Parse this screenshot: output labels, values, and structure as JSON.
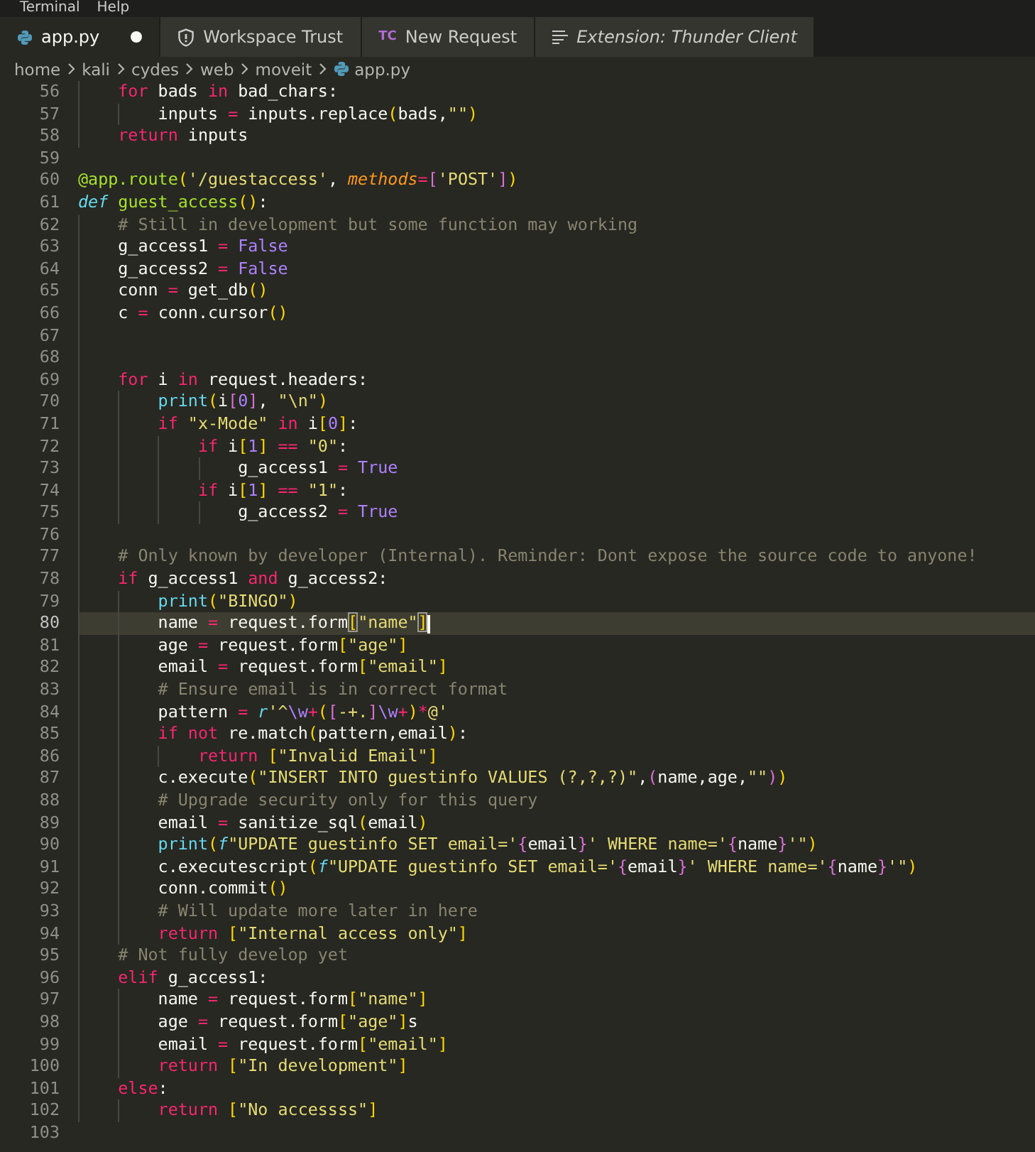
{
  "menu": [
    "Terminal",
    "Help"
  ],
  "tabs": [
    {
      "label": "app.py",
      "kind": "python",
      "selected": true,
      "modified": true,
      "preview": false
    },
    {
      "label": "Workspace Trust",
      "kind": "shield",
      "selected": false,
      "modified": false,
      "preview": false
    },
    {
      "label": "New Request",
      "kind": "badge",
      "badge": "TC",
      "selected": false,
      "modified": false,
      "preview": false
    },
    {
      "label": "Extension: Thunder Client",
      "kind": "lines",
      "selected": false,
      "modified": false,
      "preview": true
    }
  ],
  "breadcrumbs": [
    {
      "label": "home"
    },
    {
      "label": "kali"
    },
    {
      "label": "cydes"
    },
    {
      "label": "web"
    },
    {
      "label": "moveit"
    },
    {
      "label": "app.py",
      "kind": "python"
    }
  ],
  "lines": [
    {
      "number": "56",
      "current": false,
      "tokens": [
        {
          "kind": "keyword",
          "text": "    for"
        },
        {
          "kind": "plain",
          "text": " bads "
        },
        {
          "kind": "keyword",
          "text": "in"
        },
        {
          "kind": "plain",
          "text": " bad_chars:"
        }
      ]
    },
    {
      "number": "57",
      "current": false,
      "tokens": [
        {
          "kind": "plain",
          "text": "        inputs "
        },
        {
          "kind": "operator",
          "text": "="
        },
        {
          "kind": "plain",
          "text": " inputs.replace"
        },
        {
          "kind": "bracket1",
          "text": "("
        },
        {
          "kind": "plain",
          "text": "bads,"
        },
        {
          "kind": "string",
          "text": "\"\""
        },
        {
          "kind": "bracket1",
          "text": ")"
        }
      ]
    },
    {
      "number": "58",
      "current": false,
      "tokens": [
        {
          "kind": "keyword",
          "text": "    return"
        },
        {
          "kind": "plain",
          "text": " inputs"
        }
      ]
    },
    {
      "number": "59",
      "current": false
    },
    {
      "number": "60",
      "current": false,
      "tokens": [
        {
          "kind": "function",
          "text": "@app.route"
        },
        {
          "kind": "bracket1",
          "text": "("
        },
        {
          "kind": "string",
          "text": "'/guestaccess'"
        },
        {
          "kind": "plain",
          "text": ", "
        },
        {
          "kind": "parameter",
          "text": "methods"
        },
        {
          "kind": "operator",
          "text": "="
        },
        {
          "kind": "bracket2",
          "text": "["
        },
        {
          "kind": "string",
          "text": "'POST'"
        },
        {
          "kind": "bracket2",
          "text": "]"
        },
        {
          "kind": "bracket1",
          "text": ")"
        }
      ]
    },
    {
      "number": "61",
      "current": false,
      "tokens": [
        {
          "kind": "storage",
          "text": "def"
        },
        {
          "kind": "function",
          "text": " guest_access"
        },
        {
          "kind": "bracket1",
          "text": "()"
        },
        {
          "kind": "plain",
          "text": ":"
        }
      ]
    },
    {
      "number": "62",
      "current": false,
      "tokens": [
        {
          "kind": "comment",
          "text": "    # Still in development but some function may working"
        }
      ]
    },
    {
      "number": "63",
      "current": false,
      "tokens": [
        {
          "kind": "plain",
          "text": "    g_access1 "
        },
        {
          "kind": "operator",
          "text": "="
        },
        {
          "kind": "constant",
          "text": " False"
        }
      ]
    },
    {
      "number": "64",
      "current": false,
      "tokens": [
        {
          "kind": "plain",
          "text": "    g_access2 "
        },
        {
          "kind": "operator",
          "text": "="
        },
        {
          "kind": "constant",
          "text": " False"
        }
      ]
    },
    {
      "number": "65",
      "current": false,
      "tokens": [
        {
          "kind": "plain",
          "text": "    conn "
        },
        {
          "kind": "operator",
          "text": "="
        },
        {
          "kind": "plain",
          "text": " get_db"
        },
        {
          "kind": "bracket1",
          "text": "()"
        }
      ]
    },
    {
      "number": "66",
      "current": false,
      "tokens": [
        {
          "kind": "plain",
          "text": "    c "
        },
        {
          "kind": "operator",
          "text": "="
        },
        {
          "kind": "plain",
          "text": " conn.cursor"
        },
        {
          "kind": "bracket1",
          "text": "()"
        }
      ]
    },
    {
      "number": "67",
      "current": false
    },
    {
      "number": "68",
      "current": false
    },
    {
      "number": "69",
      "current": false,
      "tokens": [
        {
          "kind": "keyword",
          "text": "    for"
        },
        {
          "kind": "plain",
          "text": " i "
        },
        {
          "kind": "keyword",
          "text": "in"
        },
        {
          "kind": "plain",
          "text": " request.headers:"
        }
      ]
    },
    {
      "number": "70",
      "current": false,
      "tokens": [
        {
          "kind": "builtin",
          "text": "        print"
        },
        {
          "kind": "bracket1",
          "text": "("
        },
        {
          "kind": "plain",
          "text": "i"
        },
        {
          "kind": "bracket2",
          "text": "["
        },
        {
          "kind": "constant",
          "text": "0"
        },
        {
          "kind": "bracket2",
          "text": "]"
        },
        {
          "kind": "plain",
          "text": ", "
        },
        {
          "kind": "string",
          "text": "\"\\n\""
        },
        {
          "kind": "bracket1",
          "text": ")"
        }
      ]
    },
    {
      "number": "71",
      "current": false,
      "tokens": [
        {
          "kind": "keyword",
          "text": "        if"
        },
        {
          "kind": "string",
          "text": " \"x-Mode\""
        },
        {
          "kind": "keyword",
          "text": " in"
        },
        {
          "kind": "plain",
          "text": " i"
        },
        {
          "kind": "bracket1",
          "text": "["
        },
        {
          "kind": "constant",
          "text": "0"
        },
        {
          "kind": "bracket1",
          "text": "]"
        },
        {
          "kind": "plain",
          "text": ":"
        }
      ]
    },
    {
      "number": "72",
      "current": false,
      "tokens": [
        {
          "kind": "keyword",
          "text": "            if"
        },
        {
          "kind": "plain",
          "text": " i"
        },
        {
          "kind": "bracket1",
          "text": "["
        },
        {
          "kind": "constant",
          "text": "1"
        },
        {
          "kind": "bracket1",
          "text": "]"
        },
        {
          "kind": "operator",
          "text": " =="
        },
        {
          "kind": "string",
          "text": " \"0\""
        },
        {
          "kind": "plain",
          "text": ":"
        }
      ]
    },
    {
      "number": "73",
      "current": false,
      "tokens": [
        {
          "kind": "plain",
          "text": "                g_access1 "
        },
        {
          "kind": "operator",
          "text": "="
        },
        {
          "kind": "constant",
          "text": " True"
        }
      ]
    },
    {
      "number": "74",
      "current": false,
      "tokens": [
        {
          "kind": "keyword",
          "text": "            if"
        },
        {
          "kind": "plain",
          "text": " i"
        },
        {
          "kind": "bracket1",
          "text": "["
        },
        {
          "kind": "constant",
          "text": "1"
        },
        {
          "kind": "bracket1",
          "text": "]"
        },
        {
          "kind": "operator",
          "text": " =="
        },
        {
          "kind": "string",
          "text": " \"1\""
        },
        {
          "kind": "plain",
          "text": ":"
        }
      ]
    },
    {
      "number": "75",
      "current": false,
      "tokens": [
        {
          "kind": "plain",
          "text": "                g_access2 "
        },
        {
          "kind": "operator",
          "text": "="
        },
        {
          "kind": "constant",
          "text": " True"
        }
      ]
    },
    {
      "number": "76",
      "current": false
    },
    {
      "number": "77",
      "current": false,
      "tokens": [
        {
          "kind": "comment",
          "text": "    # Only known by developer (Internal). Reminder: Dont expose the source code to anyone!"
        }
      ]
    },
    {
      "number": "78",
      "current": false,
      "tokens": [
        {
          "kind": "keyword",
          "text": "    if"
        },
        {
          "kind": "plain",
          "text": " g_access1 "
        },
        {
          "kind": "keyword",
          "text": "and"
        },
        {
          "kind": "plain",
          "text": " g_access2:"
        }
      ]
    },
    {
      "number": "79",
      "current": false,
      "tokens": [
        {
          "kind": "builtin",
          "text": "        print"
        },
        {
          "kind": "bracket1",
          "text": "("
        },
        {
          "kind": "string",
          "text": "\"BINGO\""
        },
        {
          "kind": "bracket1",
          "text": ")"
        }
      ]
    },
    {
      "number": "80",
      "current": true,
      "tokens": [
        {
          "kind": "plain",
          "text": "        name "
        },
        {
          "kind": "operator",
          "text": "="
        },
        {
          "kind": "plain",
          "text": " request.form"
        },
        {
          "kind": "bracket_match",
          "text": "["
        },
        {
          "kind": "string",
          "text": "\"name\""
        },
        {
          "kind": "bracket_match",
          "text": "]"
        }
      ]
    },
    {
      "number": "81",
      "current": false,
      "tokens": [
        {
          "kind": "plain",
          "text": "        age "
        },
        {
          "kind": "operator",
          "text": "="
        },
        {
          "kind": "plain",
          "text": " request.form"
        },
        {
          "kind": "bracket1",
          "text": "["
        },
        {
          "kind": "string",
          "text": "\"age\""
        },
        {
          "kind": "bracket1",
          "text": "]"
        }
      ]
    },
    {
      "number": "82",
      "current": false,
      "tokens": [
        {
          "kind": "plain",
          "text": "        email "
        },
        {
          "kind": "operator",
          "text": "="
        },
        {
          "kind": "plain",
          "text": " request.form"
        },
        {
          "kind": "bracket1",
          "text": "["
        },
        {
          "kind": "string",
          "text": "\"email\""
        },
        {
          "kind": "bracket1",
          "text": "]"
        }
      ]
    },
    {
      "number": "83",
      "current": false,
      "tokens": [
        {
          "kind": "comment",
          "text": "        # Ensure email is in correct format"
        }
      ]
    },
    {
      "number": "84",
      "current": false,
      "tokens": [
        {
          "kind": "plain",
          "text": "        pattern "
        },
        {
          "kind": "operator",
          "text": "="
        },
        {
          "kind": "storage",
          "text": " r"
        },
        {
          "kind": "string",
          "text": "'^"
        },
        {
          "kind": "constant",
          "text": "\\w"
        },
        {
          "kind": "operator",
          "text": "+"
        },
        {
          "kind": "bracket1",
          "text": "("
        },
        {
          "kind": "bracket2",
          "text": "["
        },
        {
          "kind": "string",
          "text": "-+."
        },
        {
          "kind": "bracket2",
          "text": "]"
        },
        {
          "kind": "constant",
          "text": "\\w"
        },
        {
          "kind": "operator",
          "text": "+"
        },
        {
          "kind": "bracket1",
          "text": ")"
        },
        {
          "kind": "operator",
          "text": "*"
        },
        {
          "kind": "string",
          "text": "@'"
        }
      ]
    },
    {
      "number": "85",
      "current": false,
      "tokens": [
        {
          "kind": "keyword",
          "text": "        if"
        },
        {
          "kind": "keyword",
          "text": " not"
        },
        {
          "kind": "plain",
          "text": " re.match"
        },
        {
          "kind": "bracket1",
          "text": "("
        },
        {
          "kind": "plain",
          "text": "pattern,email"
        },
        {
          "kind": "bracket1",
          "text": ")"
        },
        {
          "kind": "plain",
          "text": ":"
        }
      ]
    },
    {
      "number": "86",
      "current": false,
      "tokens": [
        {
          "kind": "keyword",
          "text": "            return"
        },
        {
          "kind": "bracket1",
          "text": " ["
        },
        {
          "kind": "string",
          "text": "\"Invalid Email\""
        },
        {
          "kind": "bracket1",
          "text": "]"
        }
      ]
    },
    {
      "number": "87",
      "current": false,
      "tokens": [
        {
          "kind": "plain",
          "text": "        c.execute"
        },
        {
          "kind": "bracket1",
          "text": "("
        },
        {
          "kind": "string",
          "text": "\"INSERT INTO guestinfo VALUES (?,?,?)\""
        },
        {
          "kind": "plain",
          "text": ","
        },
        {
          "kind": "bracket2",
          "text": "("
        },
        {
          "kind": "plain",
          "text": "name,age,"
        },
        {
          "kind": "string",
          "text": "\"\""
        },
        {
          "kind": "bracket2",
          "text": ")"
        },
        {
          "kind": "bracket1",
          "text": ")"
        }
      ]
    },
    {
      "number": "88",
      "current": false,
      "tokens": [
        {
          "kind": "comment",
          "text": "        # Upgrade security only for this query"
        }
      ]
    },
    {
      "number": "89",
      "current": false,
      "tokens": [
        {
          "kind": "plain",
          "text": "        email "
        },
        {
          "kind": "operator",
          "text": "="
        },
        {
          "kind": "plain",
          "text": " sanitize_sql"
        },
        {
          "kind": "bracket1",
          "text": "("
        },
        {
          "kind": "plain",
          "text": "email"
        },
        {
          "kind": "bracket1",
          "text": ")"
        }
      ]
    },
    {
      "number": "90",
      "current": false,
      "tokens": [
        {
          "kind": "builtin",
          "text": "        print"
        },
        {
          "kind": "bracket1",
          "text": "("
        },
        {
          "kind": "storage",
          "text": "f"
        },
        {
          "kind": "string",
          "text": "\"UPDATE guestinfo SET email='"
        },
        {
          "kind": "bracket2",
          "text": "{"
        },
        {
          "kind": "plain",
          "text": "email"
        },
        {
          "kind": "bracket2",
          "text": "}"
        },
        {
          "kind": "string",
          "text": "' WHERE name='"
        },
        {
          "kind": "bracket2",
          "text": "{"
        },
        {
          "kind": "plain",
          "text": "name"
        },
        {
          "kind": "bracket2",
          "text": "}"
        },
        {
          "kind": "string",
          "text": "'\""
        },
        {
          "kind": "bracket1",
          "text": ")"
        }
      ]
    },
    {
      "number": "91",
      "current": false,
      "tokens": [
        {
          "kind": "plain",
          "text": "        c.executescript"
        },
        {
          "kind": "bracket1",
          "text": "("
        },
        {
          "kind": "storage",
          "text": "f"
        },
        {
          "kind": "string",
          "text": "\"UPDATE guestinfo SET email='"
        },
        {
          "kind": "bracket2",
          "text": "{"
        },
        {
          "kind": "plain",
          "text": "email"
        },
        {
          "kind": "bracket2",
          "text": "}"
        },
        {
          "kind": "string",
          "text": "' WHERE name='"
        },
        {
          "kind": "bracket2",
          "text": "{"
        },
        {
          "kind": "plain",
          "text": "name"
        },
        {
          "kind": "bracket2",
          "text": "}"
        },
        {
          "kind": "string",
          "text": "'\""
        },
        {
          "kind": "bracket1",
          "text": ")"
        }
      ]
    },
    {
      "number": "92",
      "current": false,
      "tokens": [
        {
          "kind": "plain",
          "text": "        conn.commit"
        },
        {
          "kind": "bracket1",
          "text": "()"
        }
      ]
    },
    {
      "number": "93",
      "current": false,
      "tokens": [
        {
          "kind": "comment",
          "text": "        # Will update more later in here"
        }
      ]
    },
    {
      "number": "94",
      "current": false,
      "tokens": [
        {
          "kind": "keyword",
          "text": "        return"
        },
        {
          "kind": "bracket1",
          "text": " ["
        },
        {
          "kind": "string",
          "text": "\"Internal access only\""
        },
        {
          "kind": "bracket1",
          "text": "]"
        }
      ]
    },
    {
      "number": "95",
      "current": false,
      "tokens": [
        {
          "kind": "comment",
          "text": "    # Not fully develop yet"
        }
      ]
    },
    {
      "number": "96",
      "current": false,
      "tokens": [
        {
          "kind": "keyword",
          "text": "    elif"
        },
        {
          "kind": "plain",
          "text": " g_access1:"
        }
      ]
    },
    {
      "number": "97",
      "current": false,
      "tokens": [
        {
          "kind": "plain",
          "text": "        name "
        },
        {
          "kind": "operator",
          "text": "="
        },
        {
          "kind": "plain",
          "text": " request.form"
        },
        {
          "kind": "bracket1",
          "text": "["
        },
        {
          "kind": "string",
          "text": "\"name\""
        },
        {
          "kind": "bracket1",
          "text": "]"
        }
      ]
    },
    {
      "number": "98",
      "current": false,
      "tokens": [
        {
          "kind": "plain",
          "text": "        age "
        },
        {
          "kind": "operator",
          "text": "="
        },
        {
          "kind": "plain",
          "text": " request.form"
        },
        {
          "kind": "bracket1",
          "text": "["
        },
        {
          "kind": "string",
          "text": "\"age\""
        },
        {
          "kind": "bracket1",
          "text": "]"
        },
        {
          "kind": "plain",
          "text": "s"
        }
      ]
    },
    {
      "number": "99",
      "current": false,
      "tokens": [
        {
          "kind": "plain",
          "text": "        email "
        },
        {
          "kind": "operator",
          "text": "="
        },
        {
          "kind": "plain",
          "text": " request.form"
        },
        {
          "kind": "bracket1",
          "text": "["
        },
        {
          "kind": "string",
          "text": "\"email\""
        },
        {
          "kind": "bracket1",
          "text": "]"
        }
      ]
    },
    {
      "number": "100",
      "current": false,
      "tokens": [
        {
          "kind": "keyword",
          "text": "        return"
        },
        {
          "kind": "bracket1",
          "text": " ["
        },
        {
          "kind": "string",
          "text": "\"In development\""
        },
        {
          "kind": "bracket1",
          "text": "]"
        }
      ]
    },
    {
      "number": "101",
      "current": false,
      "tokens": [
        {
          "kind": "keyword",
          "text": "    else"
        },
        {
          "kind": "plain",
          "text": ":"
        }
      ]
    },
    {
      "number": "102",
      "current": false,
      "tokens": [
        {
          "kind": "keyword",
          "text": "        return"
        },
        {
          "kind": "bracket1",
          "text": " ["
        },
        {
          "kind": "string",
          "text": "\"No accessss\""
        },
        {
          "kind": "bracket1",
          "text": "]"
        }
      ]
    },
    {
      "number": "103",
      "current": false
    }
  ]
}
